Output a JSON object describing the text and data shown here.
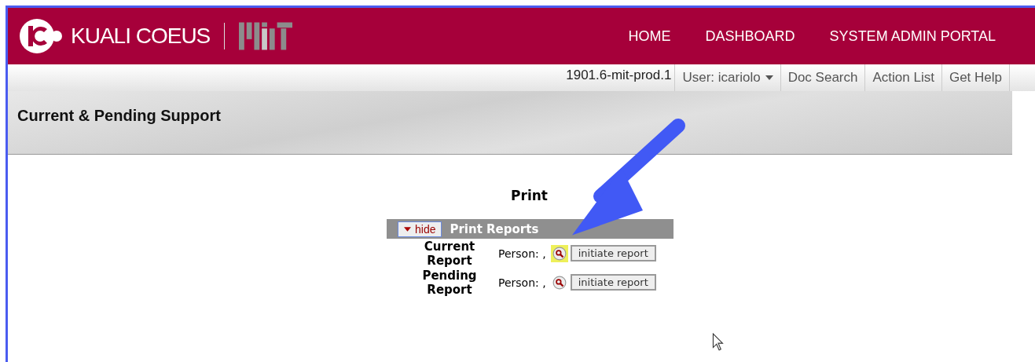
{
  "header": {
    "brand": "KUALI COEUS",
    "nav": [
      "HOME",
      "DASHBOARD",
      "SYSTEM ADMIN PORTAL"
    ]
  },
  "toolbar": {
    "version": "1901.6-mit-prod.1",
    "user_menu": "User: icariolo",
    "links": [
      "Doc Search",
      "Action List",
      "Get Help"
    ]
  },
  "page_title": "Current & Pending Support",
  "print_heading": "Print",
  "section": {
    "toggle": "hide",
    "expanded": true,
    "title": "Print Reports"
  },
  "reports": [
    {
      "label": "Current Report",
      "person": "Person: ,",
      "highlighted": true,
      "button": "initiate report"
    },
    {
      "label": "Pending Report",
      "person": "Person: ,",
      "highlighted": false,
      "button": "initiate report"
    }
  ]
}
